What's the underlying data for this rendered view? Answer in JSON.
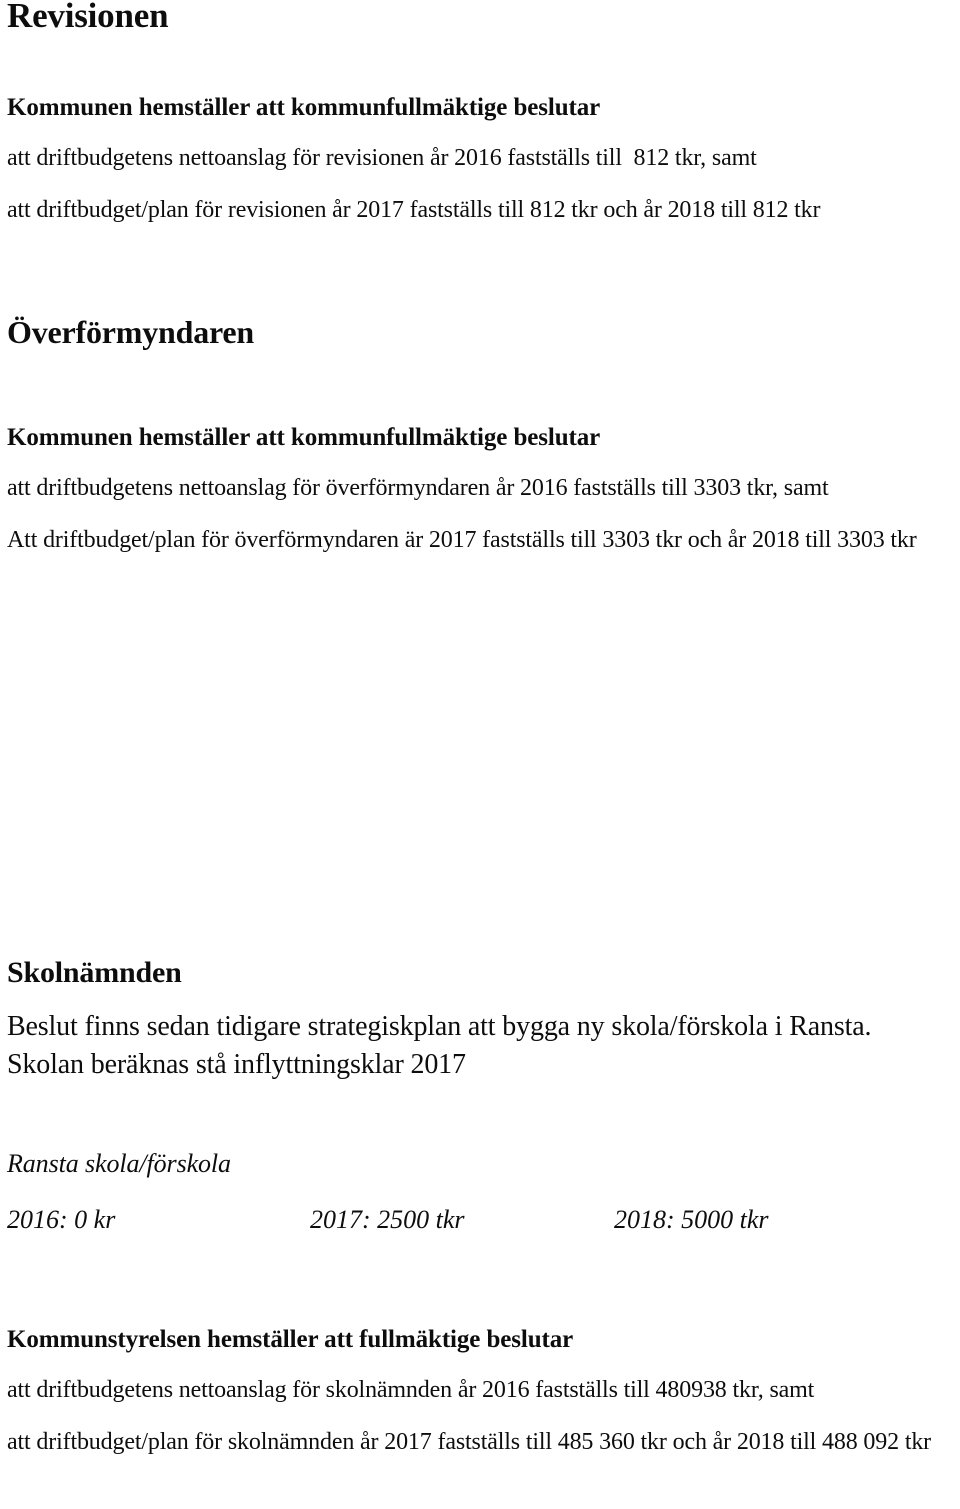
{
  "document": {
    "language": "sv",
    "background_color": "#ffffff",
    "text_color": "#0d0d0d"
  },
  "sections": [
    {
      "id": "revisionen",
      "heading": "Revisionen",
      "lead": "Kommunen hemställer att kommunfullmäktige beslutar",
      "paragraphs": [
        "att driftbudgetens nettoanslag för revisionen år 2016 fastställs till  812 tkr, samt",
        "att driftbudget/plan för revisionen år 2017 fastställs till 812 tkr och år 2018 till 812 tkr"
      ]
    },
    {
      "id": "overformyndaren",
      "heading": "Överförmyndaren",
      "lead": "Kommunen hemställer att kommunfullmäktige beslutar",
      "paragraphs": [
        "att driftbudgetens nettoanslag för överförmyndaren år 2016 fastställs till 3303 tkr, samt",
        "Att driftbudget/plan för överförmyndaren är 2017 fastställs till 3303 tkr och år 2018 till 3303 tkr"
      ]
    },
    {
      "id": "skolnamnden",
      "heading": "Skolnämnden",
      "intro": "Beslut finns sedan tidigare strategiskplan att bygga ny skola/förskola i Ransta. Skolan beräknas stå inflyttningsklar 2017",
      "project_title": "Ransta skola/förskola",
      "project_years": [
        {
          "label": "2016: 0 kr"
        },
        {
          "label": "2017: 2500 tkr"
        },
        {
          "label": "2018: 5000 tkr"
        }
      ],
      "lead": "Kommunstyrelsen hemställer att fullmäktige beslutar",
      "paragraphs": [
        "att driftbudgetens nettoanslag för skolnämnden år 2016 fastställs till 480938 tkr, samt",
        "att driftbudget/plan för skolnämnden år 2017 fastställs till 485 360 tkr och år 2018 till 488 092 tkr"
      ]
    }
  ]
}
